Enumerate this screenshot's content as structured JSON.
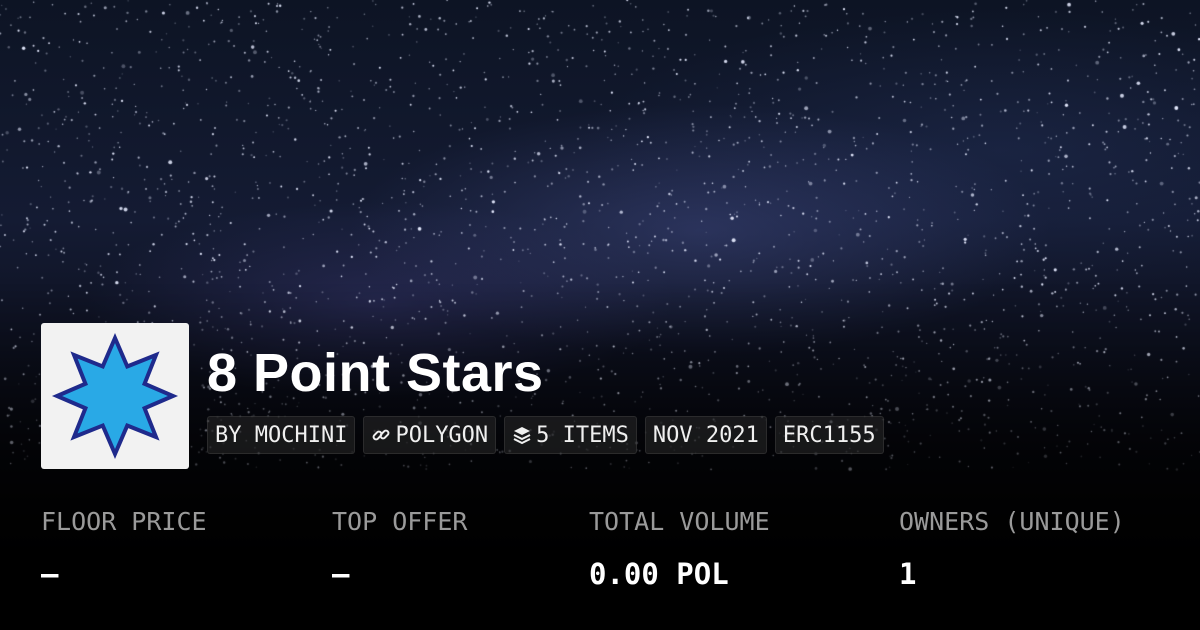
{
  "collection": {
    "title": "8 Point Stars",
    "logo_icon": "eight-point-star-icon",
    "logo_colors": {
      "fill": "#29a9e6",
      "stroke": "#1f2a8c",
      "background": "#f2f2f2"
    }
  },
  "tags": [
    {
      "label": "BY MOCHINI",
      "icon": ""
    },
    {
      "label": "POLYGON",
      "icon": "chain-link-icon"
    },
    {
      "label": "5 ITEMS",
      "icon": "layers-icon"
    },
    {
      "label": "NOV 2021",
      "icon": ""
    },
    {
      "label": "ERC1155",
      "icon": ""
    }
  ],
  "stats": [
    {
      "label": "FLOOR PRICE",
      "value": "–"
    },
    {
      "label": "TOP OFFER",
      "value": "–"
    },
    {
      "label": "TOTAL VOLUME",
      "value": "0.00 POL"
    },
    {
      "label": "OWNERS (UNIQUE)",
      "value": "1"
    }
  ]
}
